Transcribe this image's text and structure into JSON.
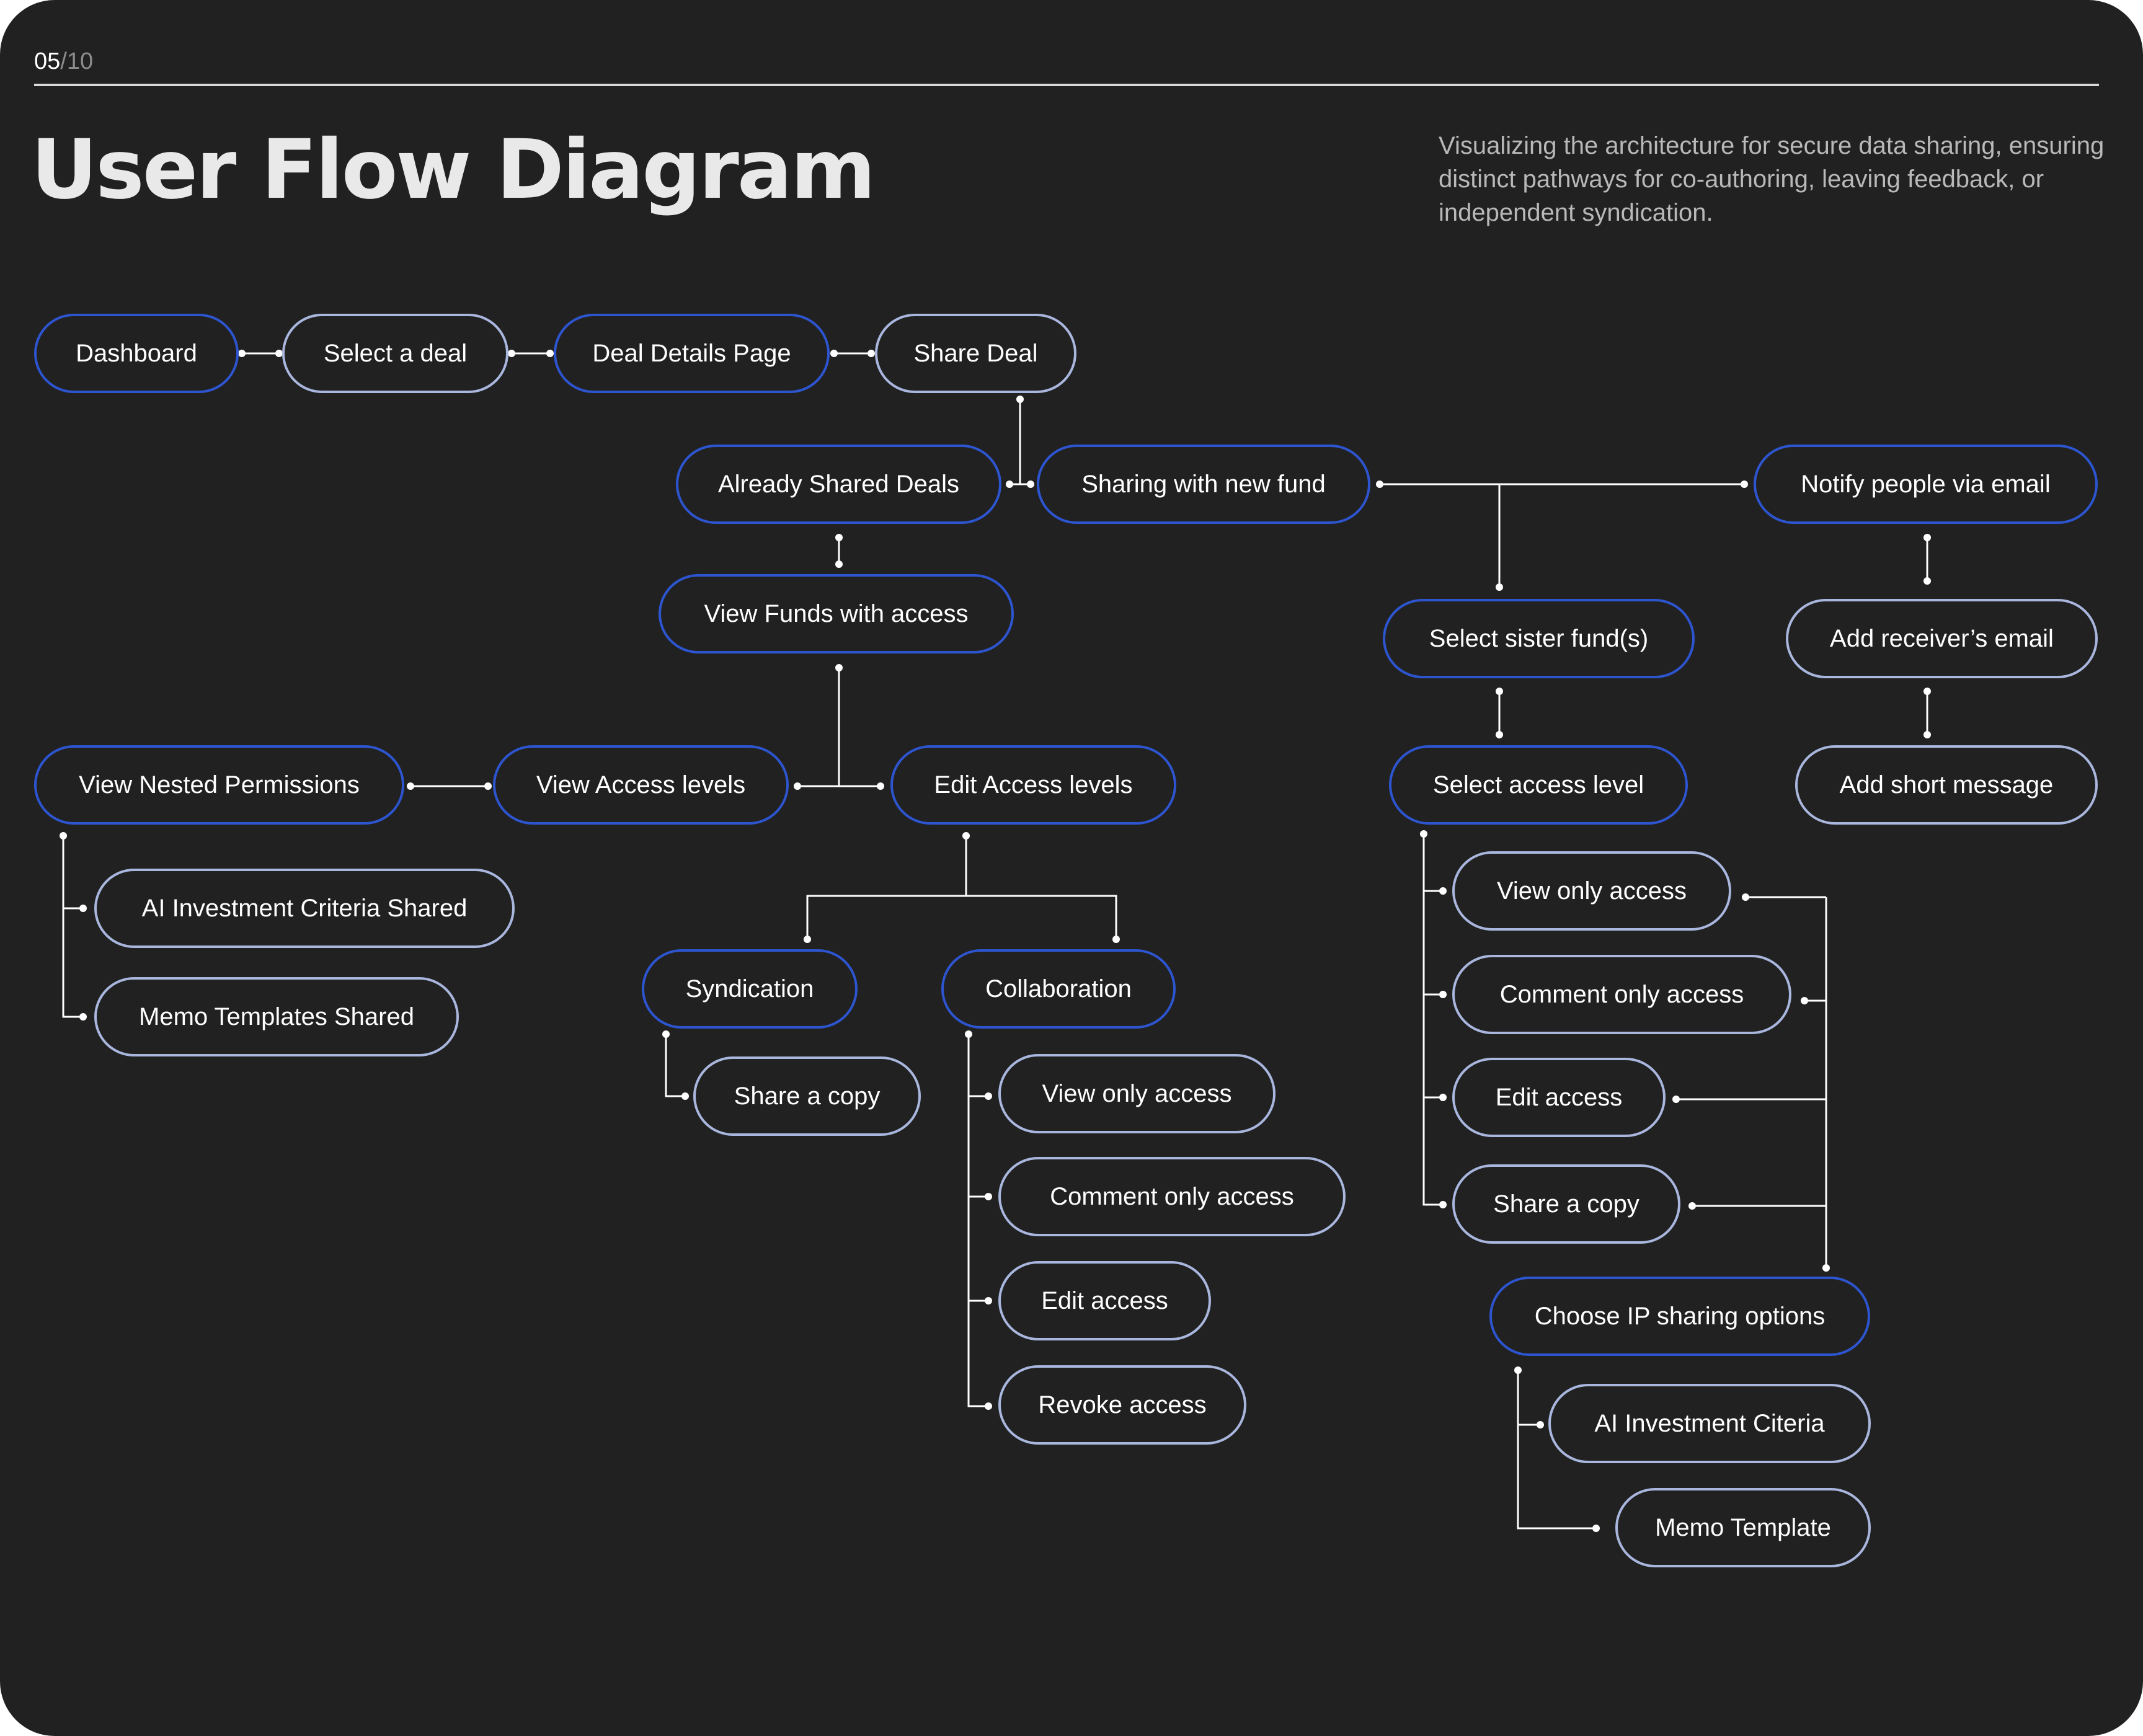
{
  "page": {
    "current": "05",
    "total": "/10"
  },
  "title": "User Flow Diagram",
  "subtitle": "Visualizing the architecture for secure data sharing, ensuring distinct pathways for co-authoring, leaving feedback, or independent syndication.",
  "colors": {
    "background": "#212121",
    "primary_border": "#2d55d0",
    "secondary_border": "#a9b6dd",
    "connector": "#ffffff",
    "text": "#ffffff"
  },
  "nodes": {
    "dashboard": "Dashboard",
    "select_deal": "Select a deal",
    "deal_details": "Deal Details Page",
    "share_deal": "Share Deal",
    "already_shared": "Already Shared Deals",
    "sharing_new_fund": "Sharing with new fund",
    "notify_email": "Notify people via email",
    "view_funds": "View Funds with access",
    "select_sister": "Select sister fund(s)",
    "add_receiver": "Add receiver’s email",
    "view_nested": "View Nested Permissions",
    "view_access_levels": "View Access levels",
    "edit_access_levels": "Edit Access levels",
    "select_access_level": "Select access level",
    "add_short_message": "Add short message",
    "ai_shared": "AI Investment Criteria Shared",
    "memo_shared": "Memo Templates Shared",
    "syndication": "Syndication",
    "collaboration": "Collaboration",
    "synd_share_copy": "Share a copy",
    "collab_view_only": "View only access",
    "collab_comment_only": "Comment only access",
    "collab_edit": "Edit access",
    "collab_revoke": "Revoke access",
    "sister_view_only": "View only access",
    "sister_comment_only": "Comment only access",
    "sister_edit": "Edit access",
    "sister_share_copy": "Share a copy",
    "ip_options": "Choose IP sharing options",
    "ai_criteria": "AI Investment Citeria",
    "memo_template": "Memo Template"
  }
}
